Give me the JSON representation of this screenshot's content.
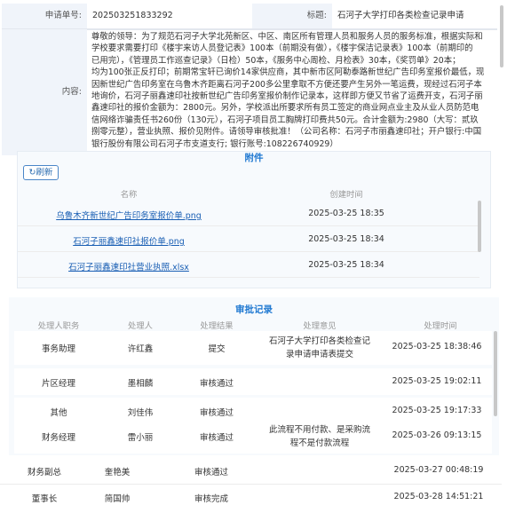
{
  "header": {
    "order_label": "申请单号:",
    "order_value": "202503251833292",
    "title_label": "标题:",
    "title_value": "石河子大学打印各类检查记录申请",
    "content_label": "内容:",
    "content_lines": [
      "尊敬的领导：为了规范石河子大学北苑新区、中区、南区所有管理人员和服务人员的服务标准，根据实际和",
      "学校要求需要打印《楼宇来访人员登记表》100本（前期没有做），《楼宇保洁记录表》100本（前期印的",
      "已用完），《管理员工作巡查记录》（日检）50本，《服务中心周检、月检表》30本，《奖罚单》20本；",
      "均为100张正反打印；前期常宝轩已询价14家供应商，其中新市区阿勒泰路新世纪广告印务室报价最低，现",
      "因新世纪广告印务室在乌鲁木齐距离石河子200多公里拿取不方便还要产生另外一笔运费，现经过石河子本",
      "地询价，石河子丽鑫速印社按新世纪广告印务室报价制作记录本，这样即方便又节省了运费开支，石河子丽",
      "鑫速印社的报价金额为：2800元。另外，学校派出所要求所有员工签定的商业网点业主及从业人员防范电",
      "信网络诈骗责任书260份（130元），石河子项目员工胸牌打印费共50元。合计金额为:2980（大写：贰玖",
      "捌零元整），营业执照、报价见附件。请领导审核批准！（公司名称：石河子市丽鑫速印社；开户银行:中国",
      "银行股份有限公司石河子市支道支行; 银行账号:108226740929）"
    ]
  },
  "attachments": {
    "title": "附件",
    "refresh_label": "刷新",
    "col_name": "名称",
    "col_time": "创建时间",
    "items": [
      {
        "name": "乌鲁木齐新世纪广告印务室报价单.png",
        "time": "2025-03-25 18:35"
      },
      {
        "name": "石河子丽鑫速印社报价单.png",
        "time": "2025-03-25 18:34"
      },
      {
        "name": "石河子丽鑫速印社营业执照.xlsx",
        "time": "2025-03-25 18:34"
      }
    ]
  },
  "approval": {
    "title": "审批记录",
    "columns": [
      "处理人职务",
      "处理人",
      "处理结果",
      "处理意见",
      "处理时间"
    ],
    "rows": [
      {
        "role": "事务助理",
        "person": "许红鑫",
        "result": "提交",
        "opinion": [
          "石河子大学打印各类检查记",
          "录申请申请表提交"
        ],
        "time": "2025-03-25 18:38:46"
      },
      {
        "role": "片区经理",
        "person": "墨相麟",
        "result": "审核通过",
        "opinion": [],
        "time": "2025-03-25 19:02:11"
      },
      {
        "role": "其他",
        "person": "刘佳伟",
        "result": "审核通过",
        "opinion": [],
        "time": "2025-03-25 19:17:33"
      },
      {
        "role": "财务经理",
        "person": "雷小丽",
        "result": "审核通过",
        "opinion": [
          "此流程不用付款、是采购流",
          "程不是付款流程"
        ],
        "time": "2025-03-26 09:13:15"
      },
      {
        "role": "财务副总",
        "person": "奎艳美",
        "result": "审核通过",
        "opinion": [],
        "time": "2025-03-27 00:48:19"
      },
      {
        "role": "董事长",
        "person": "简国帅",
        "result": "审核完成",
        "opinion": [],
        "time": "2025-03-28 14:51:21"
      }
    ]
  },
  "colors": {
    "accent": "#1f78d1",
    "label_bg": "#f0f4fa",
    "link": "#1a5fb4"
  }
}
